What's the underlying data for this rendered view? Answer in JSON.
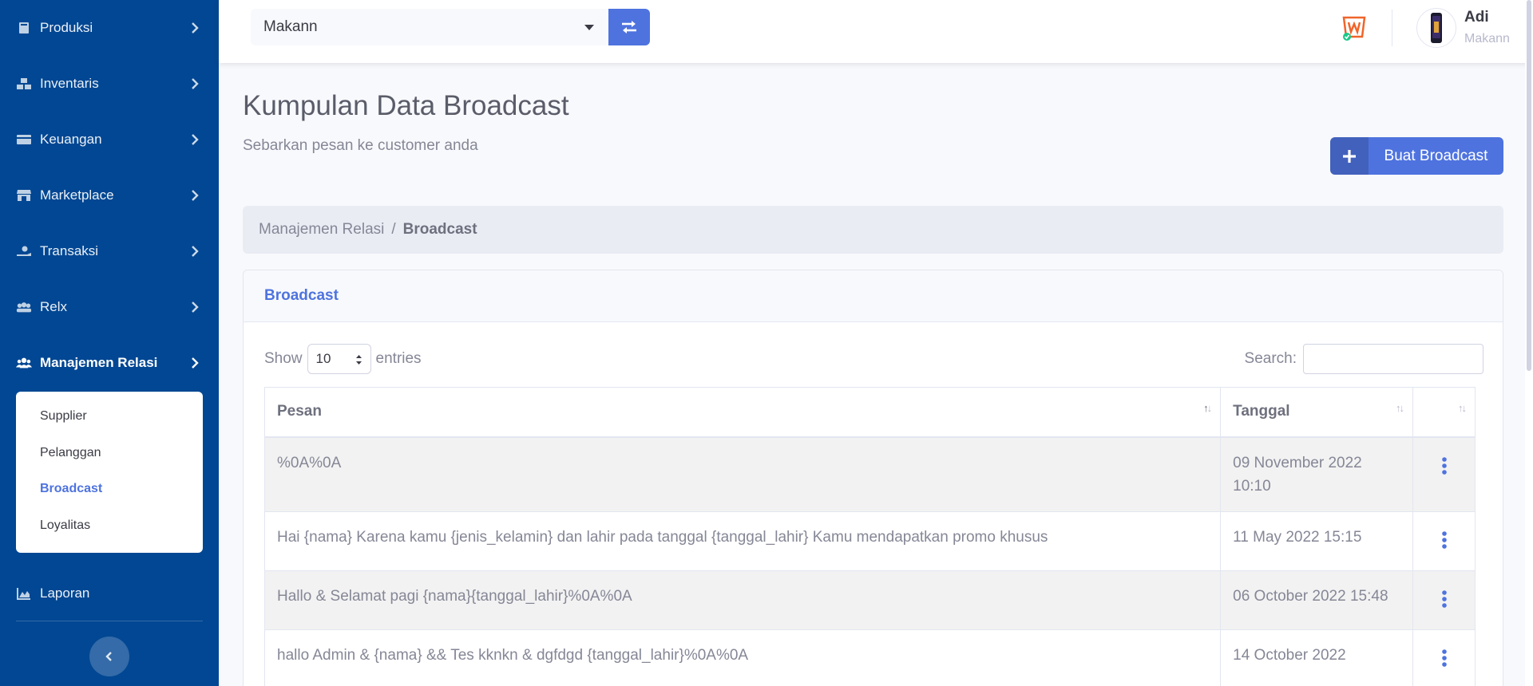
{
  "sidebar": {
    "items": [
      {
        "label": "Produksi",
        "icon": "book-icon"
      },
      {
        "label": "Inventaris",
        "icon": "boxes-icon"
      },
      {
        "label": "Keuangan",
        "icon": "money-icon"
      },
      {
        "label": "Marketplace",
        "icon": "store-icon"
      },
      {
        "label": "Transaksi",
        "icon": "hand-coin-icon"
      },
      {
        "label": "Relx",
        "icon": "people-icon"
      },
      {
        "label": "Manajemen Relasi",
        "icon": "users-icon"
      },
      {
        "label": "Laporan",
        "icon": "chart-area-icon"
      }
    ],
    "submenu": [
      "Supplier",
      "Pelanggan",
      "Broadcast",
      "Loyalitas"
    ],
    "active_submenu": "Broadcast"
  },
  "topbar": {
    "outlet_select": "Makann",
    "user_name": "Adi",
    "user_outlet": "Makann"
  },
  "page": {
    "title": "Kumpulan Data Broadcast",
    "subtitle": "Sebarkan pesan ke customer anda",
    "create_button": "Buat Broadcast"
  },
  "breadcrumb": {
    "parent": "Manajemen Relasi",
    "separator": "/",
    "current": "Broadcast"
  },
  "card": {
    "title": "Broadcast",
    "show_label": "Show",
    "entries_value": "10",
    "entries_label": "entries",
    "search_label": "Search:"
  },
  "table": {
    "columns": [
      "Pesan",
      "Tanggal",
      ""
    ],
    "rows": [
      {
        "pesan": "%0A%0A",
        "tanggal": "09 November 2022 10:10"
      },
      {
        "pesan": "Hai {nama} Karena kamu {jenis_kelamin} dan lahir pada tanggal {tanggal_lahir} Kamu mendapatkan promo khusus",
        "tanggal": "11 May 2022 15:15"
      },
      {
        "pesan": "Hallo & Selamat pagi {nama}{tanggal_lahir}%0A%0A",
        "tanggal": "06 October 2022 15:48"
      },
      {
        "pesan": "hallo Admin & {nama} && Tes kknkn & dgfdgd {tanggal_lahir}%0A%0A",
        "tanggal": "14 October 2022"
      }
    ]
  },
  "colors": {
    "sidebar_bg": "#024793",
    "primary": "#4e73df",
    "page_bg": "#f8f9fc"
  }
}
